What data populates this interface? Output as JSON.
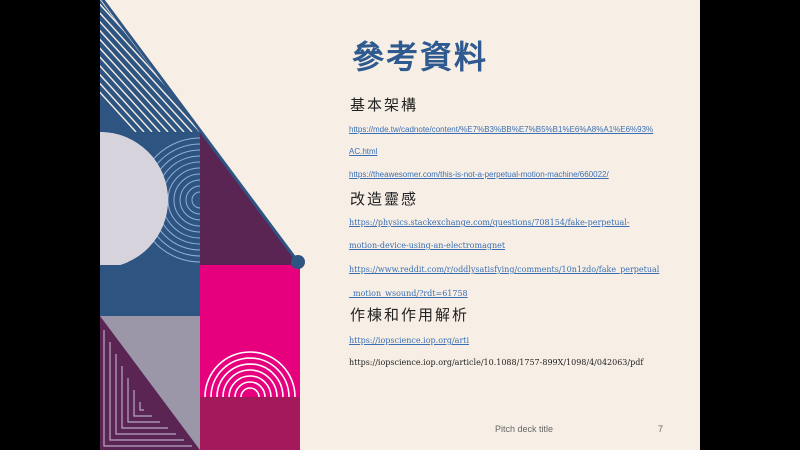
{
  "slide": {
    "title": "參考資料",
    "sections": [
      {
        "heading": "基本架構",
        "links": [
          "https://mde.tw/cadnote/content/%E7%B3%BB%E7%B5%B1%E6%A8%A1%E6%93%",
          "AC.html",
          "https://theawesomer.com/this-is-not-a-perpetual-motion-machine/660022/"
        ]
      },
      {
        "heading": "改造靈感",
        "links": [
          "https://physics.stackexchange.com/questions/708154/fake-perpetual-",
          "motion-device-using-an-electromagnet",
          "https://www.reddit.com/r/oddlysatisfying/comments/10n1zdo/fake_perpetual",
          "_motion_wsound/?rdt=61758"
        ]
      },
      {
        "heading": "作棟和作用解析",
        "links": [
          "https://iopscience.iop.org/arti",
          "https://iopscience.iop.org/article/10.1088/1757-899X/1098/4/042063/pdf"
        ]
      }
    ],
    "footer": "Pitch deck title",
    "page_number": "7"
  },
  "colors": {
    "background": "#f7efe5",
    "title": "#2f5a8f",
    "link": "#3a6fb5",
    "navy": "#2e5482",
    "magenta": "#e6007e",
    "plum": "#5a2453",
    "lilac": "#d7d3dc"
  }
}
